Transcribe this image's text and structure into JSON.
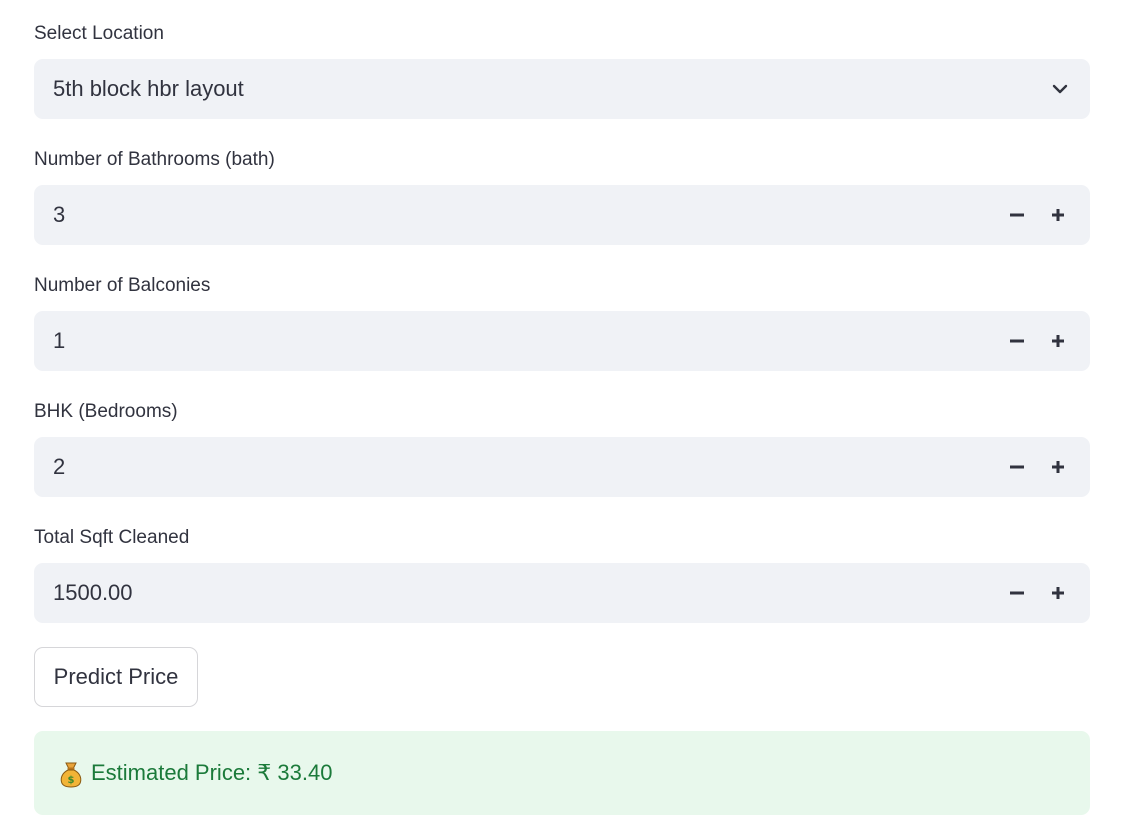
{
  "location": {
    "label": "Select Location",
    "selected": "5th block hbr layout",
    "icon": "chevron-down-icon"
  },
  "bathrooms": {
    "label": "Number of Bathrooms (bath)",
    "value": "3"
  },
  "balconies": {
    "label": "Number of Balconies",
    "value": "1"
  },
  "bhk": {
    "label": "BHK (Bedrooms)",
    "value": "2"
  },
  "sqft": {
    "label": "Total Sqft Cleaned",
    "value": "1500.00"
  },
  "stepper": {
    "minus_icon": "minus-icon",
    "plus_icon": "plus-icon"
  },
  "predict_button": {
    "label": "Predict Price"
  },
  "result": {
    "icon": "money-bag-icon",
    "text": "Estimated Price: ₹ 33.40"
  },
  "colors": {
    "input_bg": "#f0f2f6",
    "text": "#31333f",
    "success_bg": "#e8f8ec",
    "success_text": "#1b7a3a"
  }
}
